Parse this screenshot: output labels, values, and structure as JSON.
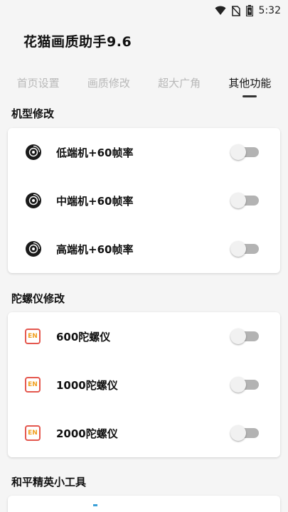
{
  "status_bar": {
    "time": "5:32"
  },
  "app": {
    "title": "花猫画质助手9.6"
  },
  "tabs": [
    {
      "label": "首页设置",
      "active": false
    },
    {
      "label": "画质修改",
      "active": false
    },
    {
      "label": "超大广角",
      "active": false
    },
    {
      "label": "其他功能",
      "active": true
    }
  ],
  "sections": [
    {
      "title": "机型修改",
      "items": [
        {
          "label": "低端机+60帧率",
          "icon": "disc-icon",
          "on": false
        },
        {
          "label": "中端机+60帧率",
          "icon": "disc-icon",
          "on": false
        },
        {
          "label": "高端机+60帧率",
          "icon": "disc-icon",
          "on": false
        }
      ]
    },
    {
      "title": "陀螺仪修改",
      "items": [
        {
          "label": "600陀螺仪",
          "icon": "en-icon",
          "on": false
        },
        {
          "label": "1000陀螺仪",
          "icon": "en-icon",
          "on": false
        },
        {
          "label": "2000陀螺仪",
          "icon": "en-icon",
          "on": false
        }
      ]
    },
    {
      "title": "和平精英小工具",
      "items": []
    }
  ],
  "icons": {
    "en_text": "EN"
  },
  "colors": {
    "toggle_off_track": "#b3b3b3",
    "en_border": "#e4574e",
    "en_text": "#f0a020"
  }
}
